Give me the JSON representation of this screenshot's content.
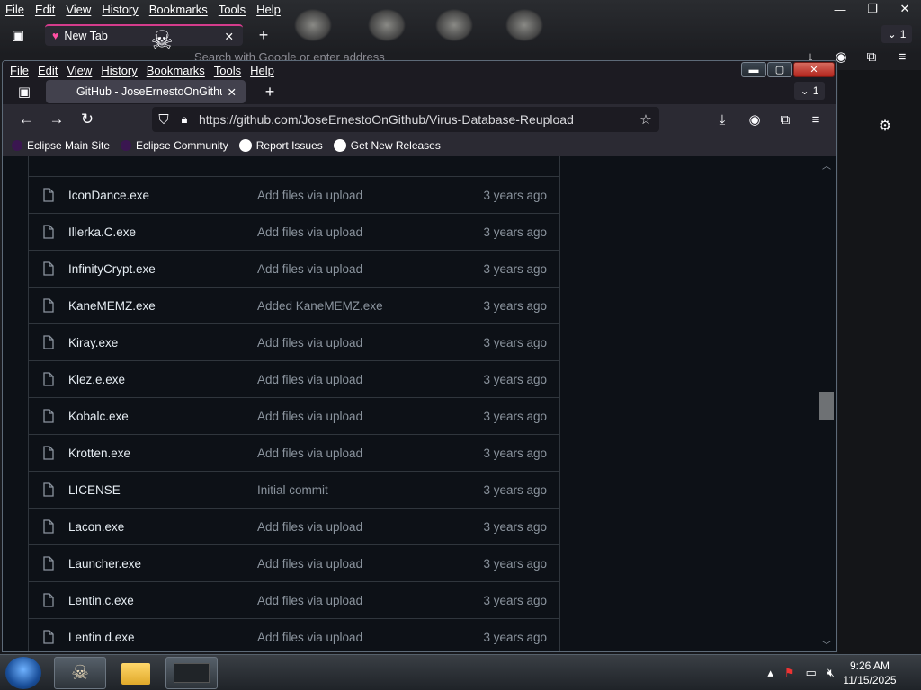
{
  "background_window": {
    "menu": [
      "File",
      "Edit",
      "View",
      "History",
      "Bookmarks",
      "Tools",
      "Help"
    ],
    "tab_title": "New Tab",
    "tab_count": "1",
    "search_placeholder": "Search with Google or enter address"
  },
  "window": {
    "menu": [
      "File",
      "Edit",
      "View",
      "History",
      "Bookmarks",
      "Tools",
      "Help"
    ],
    "tab_title": "GitHub - JoseErnestoOnGithub/",
    "tab_count": "1",
    "url": "https://github.com/JoseErnestoOnGithub/Virus-Database-Reupload",
    "bookmarks": [
      "Eclipse Main Site",
      "Eclipse Community",
      "Report Issues",
      "Get New Releases"
    ]
  },
  "files": [
    {
      "name": "IconDance.exe",
      "message": "Add files via upload",
      "age": "3 years ago"
    },
    {
      "name": "Illerka.C.exe",
      "message": "Add files via upload",
      "age": "3 years ago"
    },
    {
      "name": "InfinityCrypt.exe",
      "message": "Add files via upload",
      "age": "3 years ago"
    },
    {
      "name": "KaneMEMZ.exe",
      "message": "Added KaneMEMZ.exe",
      "age": "3 years ago"
    },
    {
      "name": "Kiray.exe",
      "message": "Add files via upload",
      "age": "3 years ago"
    },
    {
      "name": "Klez.e.exe",
      "message": "Add files via upload",
      "age": "3 years ago"
    },
    {
      "name": "Kobalc.exe",
      "message": "Add files via upload",
      "age": "3 years ago"
    },
    {
      "name": "Krotten.exe",
      "message": "Add files via upload",
      "age": "3 years ago"
    },
    {
      "name": "LICENSE",
      "message": "Initial commit",
      "age": "3 years ago"
    },
    {
      "name": "Lacon.exe",
      "message": "Add files via upload",
      "age": "3 years ago"
    },
    {
      "name": "Launcher.exe",
      "message": "Add files via upload",
      "age": "3 years ago"
    },
    {
      "name": "Lentin.c.exe",
      "message": "Add files via upload",
      "age": "3 years ago"
    },
    {
      "name": "Lentin.d.exe",
      "message": "Add files via upload",
      "age": "3 years ago"
    }
  ],
  "taskbar": {
    "time": "9:26 AM",
    "date": "11/15/2025"
  },
  "colors": {
    "accent_tab": "#d43c8c",
    "page_bg": "#0d1117",
    "border": "#30363d"
  }
}
